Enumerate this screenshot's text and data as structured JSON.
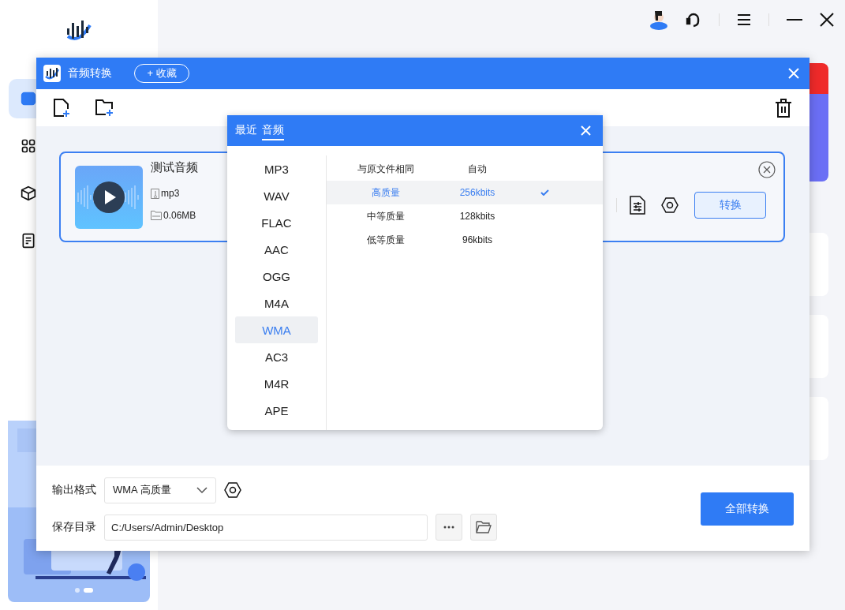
{
  "sidebar": {
    "items": [
      {
        "selected": true
      },
      {
        "selected": false
      },
      {
        "selected": false
      },
      {
        "selected": false
      }
    ]
  },
  "dialog": {
    "title": "音频转换",
    "favorite_button": "+ 收藏",
    "file": {
      "name": "测试音频",
      "format": "mp3",
      "size": "0.06MB",
      "convert_button": "转换"
    },
    "format_popup": {
      "tabs": [
        {
          "label": "最近",
          "selected": false
        },
        {
          "label": "音频",
          "selected": true
        }
      ],
      "formats": [
        {
          "label": "MP3",
          "selected": false
        },
        {
          "label": "WAV",
          "selected": false
        },
        {
          "label": "FLAC",
          "selected": false
        },
        {
          "label": "AAC",
          "selected": false
        },
        {
          "label": "OGG",
          "selected": false
        },
        {
          "label": "M4A",
          "selected": false
        },
        {
          "label": "WMA",
          "selected": true
        },
        {
          "label": "AC3",
          "selected": false
        },
        {
          "label": "M4R",
          "selected": false
        },
        {
          "label": "APE",
          "selected": false
        }
      ],
      "qualities": [
        {
          "name": "与原文件相同",
          "bitrate": "自动",
          "selected": false
        },
        {
          "name": "高质量",
          "bitrate": "256kbits",
          "selected": true
        },
        {
          "name": "中等质量",
          "bitrate": "128kbits",
          "selected": false
        },
        {
          "name": "低等质量",
          "bitrate": "96kbits",
          "selected": false
        }
      ]
    },
    "output_format": {
      "label": "输出格式",
      "value": "WMA 高质量"
    },
    "save_dir": {
      "label": "保存目录",
      "value": "C:/Users/Admin/Desktop"
    },
    "convert_all_button": "全部转换"
  }
}
